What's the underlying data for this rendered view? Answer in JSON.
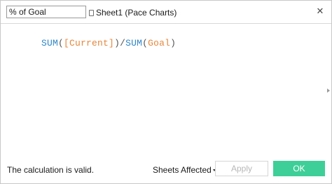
{
  "header": {
    "calc_name": "% of Goal",
    "data_source": "Sheet1 (Pace Charts)",
    "close_icon": "close-icon"
  },
  "formula": {
    "tokens": [
      {
        "text": "SUM",
        "type": "function"
      },
      {
        "text": "(",
        "type": "operator"
      },
      {
        "text": "[Current]",
        "type": "field"
      },
      {
        "text": ")",
        "type": "operator"
      },
      {
        "text": "/",
        "type": "operator"
      },
      {
        "text": "SUM",
        "type": "function"
      },
      {
        "text": "(",
        "type": "operator"
      },
      {
        "text": "Goal",
        "type": "field"
      },
      {
        "text": ")",
        "type": "operator"
      }
    ]
  },
  "footer": {
    "status": "The calculation is valid.",
    "sheets_affected": "Sheets Affected",
    "apply_label": "Apply",
    "ok_label": "OK"
  },
  "colors": {
    "function": "#2f86c7",
    "field": "#e5873c",
    "ok_button": "#3ecf98"
  }
}
